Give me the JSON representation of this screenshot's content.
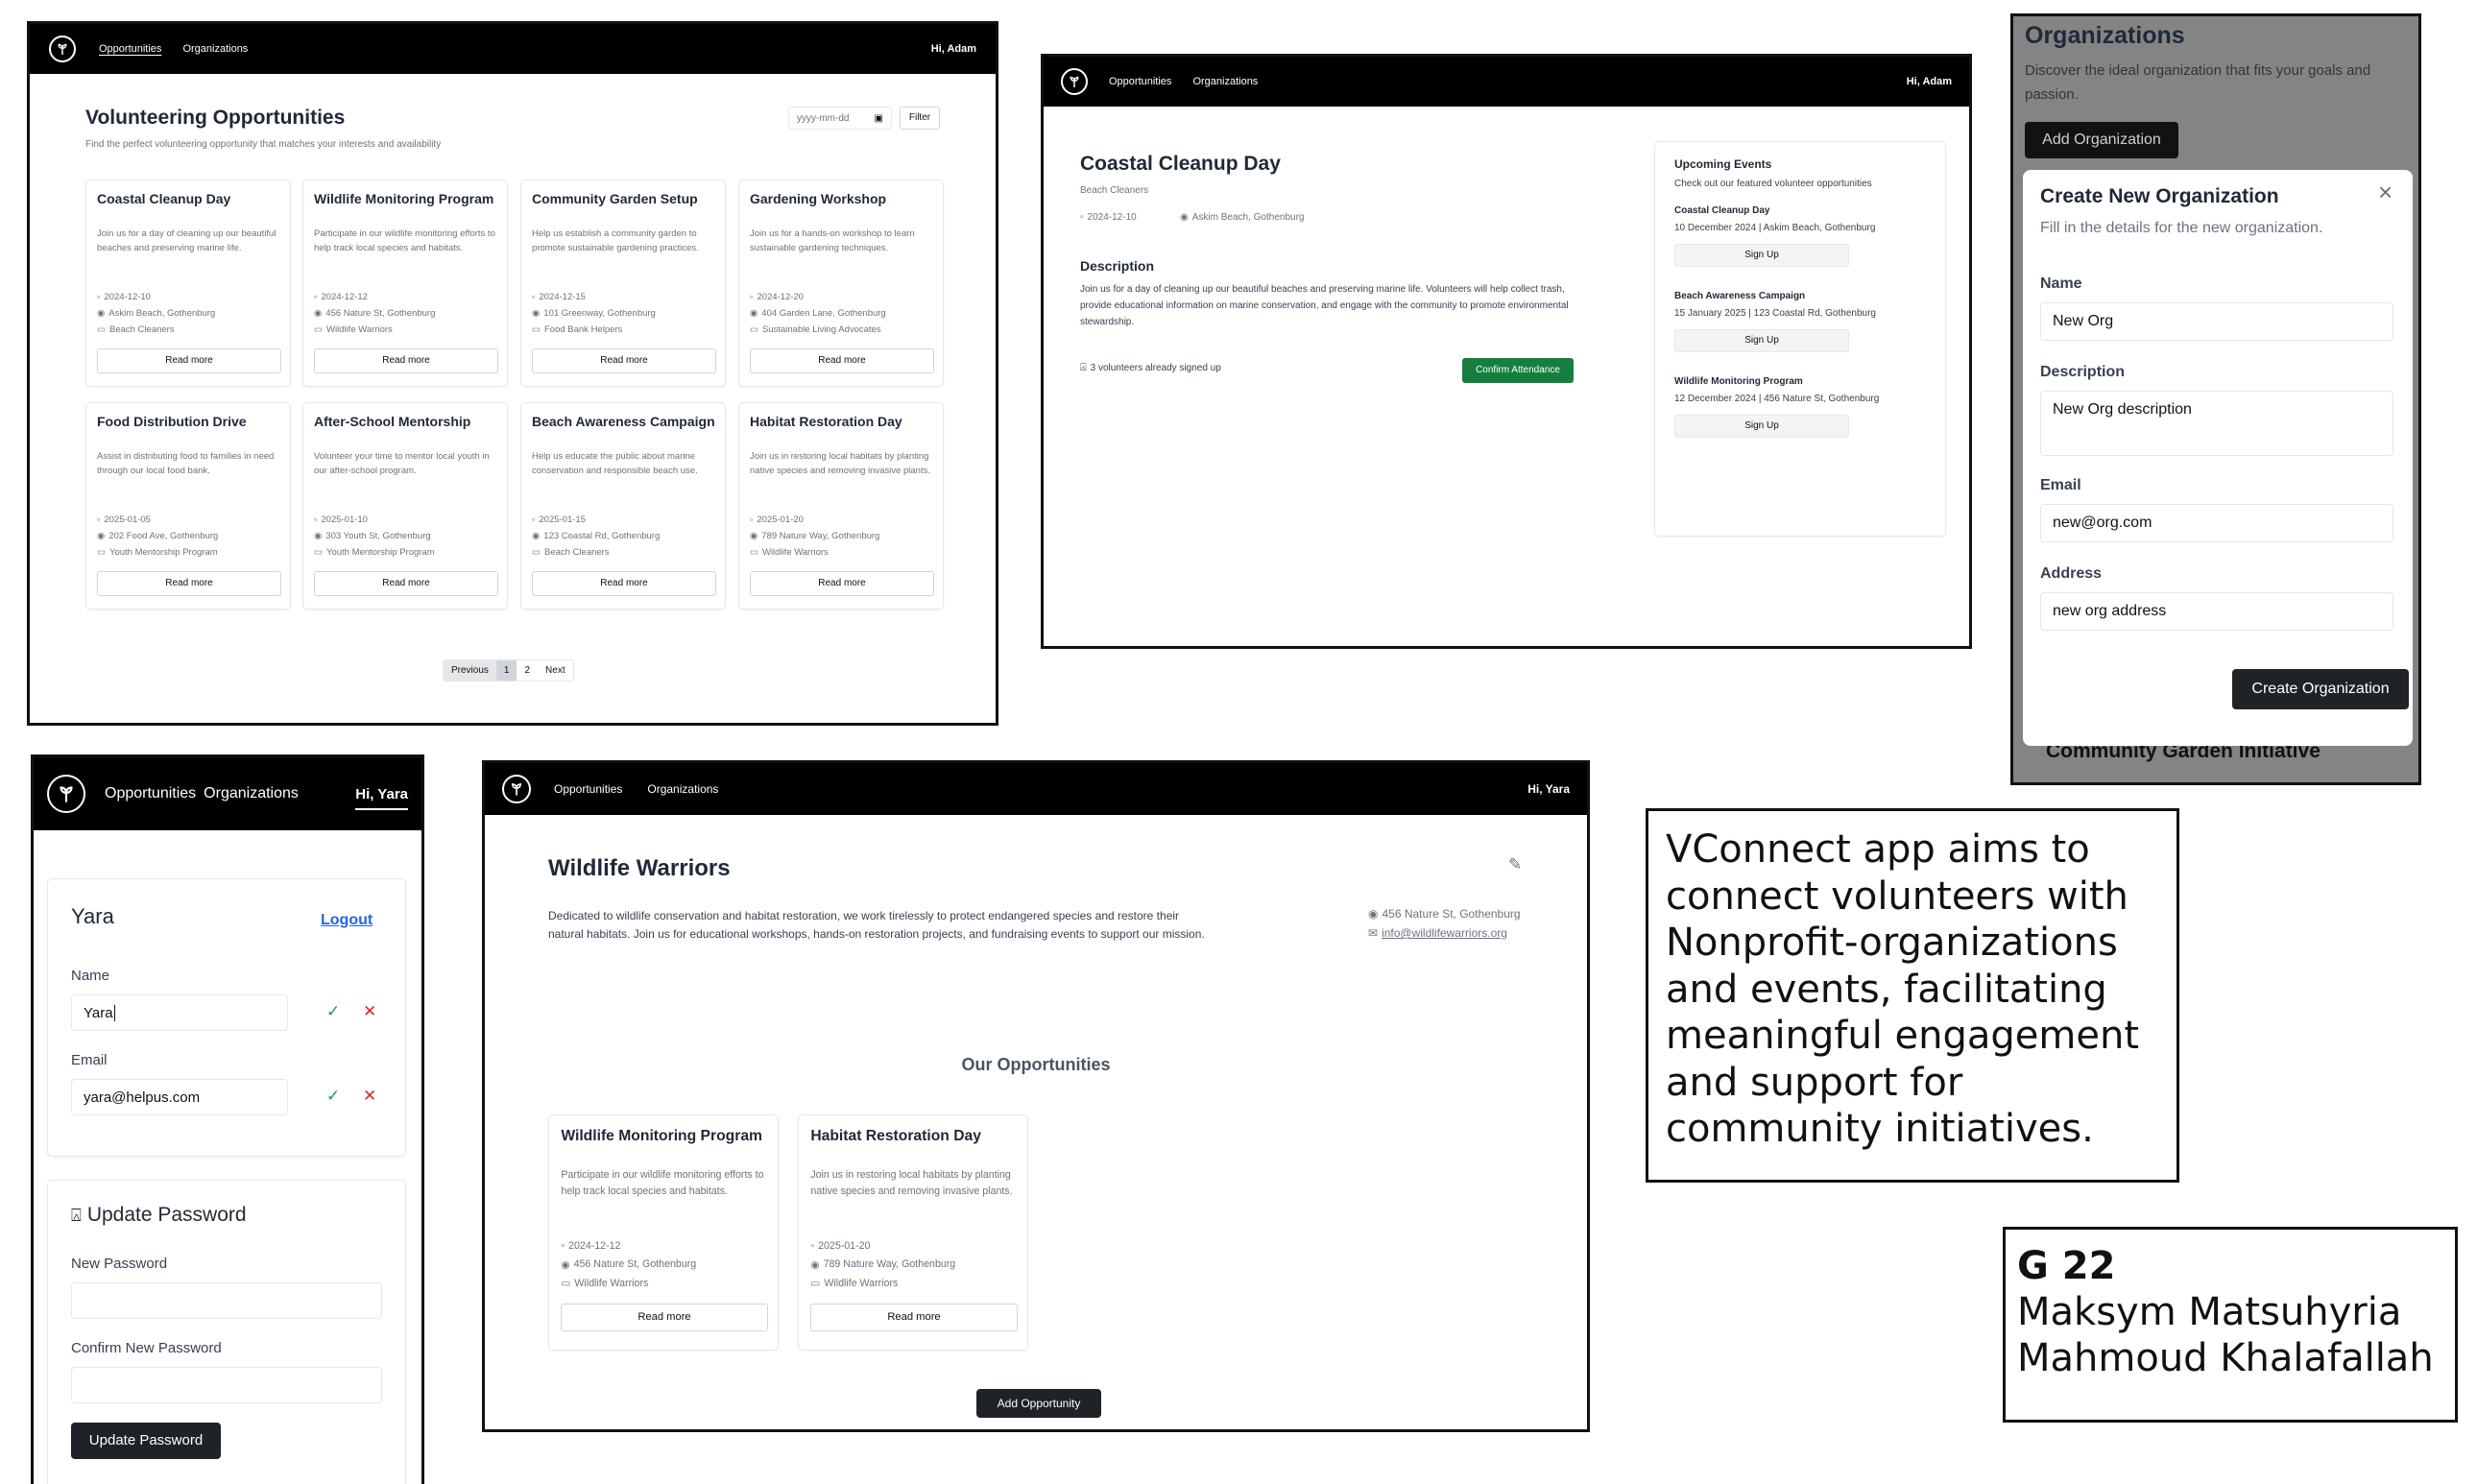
{
  "w1": {
    "nav": {
      "opportunities": "Opportunities",
      "organizations": "Organizations",
      "greeting": "Hi, Adam"
    },
    "title": "Volunteering Opportunities",
    "subtitle": "Find the perfect volunteering opportunity that matches your interests and availability",
    "date_placeholder": "yyyy-mm-dd",
    "filter": "Filter",
    "read_more": "Read more",
    "cards": [
      {
        "title": "Coastal Cleanup Day",
        "desc": "Join us for a day of cleaning up our beautiful beaches and preserving marine life.",
        "date": "2024-12-10",
        "loc": "Askim Beach, Gothenburg",
        "org": "Beach Cleaners"
      },
      {
        "title": "Wildlife Monitoring Program",
        "desc": "Participate in our wildlife monitoring efforts to help track local species and habitats.",
        "date": "2024-12-12",
        "loc": "456 Nature St, Gothenburg",
        "org": "Wildlife Warriors"
      },
      {
        "title": "Community Garden Setup",
        "desc": "Help us establish a community garden to promote sustainable gardening practices.",
        "date": "2024-12-15",
        "loc": "101 Greenway, Gothenburg",
        "org": "Food Bank Helpers"
      },
      {
        "title": "Gardening Workshop",
        "desc": "Join us for a hands-on workshop to learn sustainable gardening techniques.",
        "date": "2024-12-20",
        "loc": "404 Garden Lane, Gothenburg",
        "org": "Sustainable Living Advocates"
      },
      {
        "title": "Food Distribution Drive",
        "desc": "Assist in distributing food to families in need through our local food bank.",
        "date": "2025-01-05",
        "loc": "202 Food Ave, Gothenburg",
        "org": "Youth Mentorship Program"
      },
      {
        "title": "After-School Mentorship",
        "desc": "Volunteer your time to mentor local youth in our after-school program.",
        "date": "2025-01-10",
        "loc": "303 Youth St, Gothenburg",
        "org": "Youth Mentorship Program"
      },
      {
        "title": "Beach Awareness Campaign",
        "desc": "Help us educate the public about marine conservation and responsible beach use.",
        "date": "2025-01-15",
        "loc": "123 Coastal Rd, Gothenburg",
        "org": "Beach Cleaners"
      },
      {
        "title": "Habitat Restoration Day",
        "desc": "Join us in restoring local habitats by planting native species and removing invasive plants.",
        "date": "2025-01-20",
        "loc": "789 Nature Way, Gothenburg",
        "org": "Wildlife Warriors"
      }
    ],
    "pagination": {
      "prev": "Previous",
      "p1": "1",
      "p2": "2",
      "next": "Next"
    }
  },
  "w2": {
    "nav": {
      "opportunities": "Opportunities",
      "organizations": "Organizations",
      "greeting": "Hi, Adam"
    },
    "title": "Coastal Cleanup Day",
    "org": "Beach Cleaners",
    "date": "2024-12-10",
    "loc": "Askim Beach, Gothenburg",
    "desc_label": "Description",
    "desc": "Join us for a day of cleaning up our beautiful beaches and preserving marine life. Volunteers will help collect trash, provide educational information on marine conservation, and engage with the community to promote environmental stewardship.",
    "volunteers": "3 volunteers already signed up",
    "confirm": "Confirm Attendance",
    "upcoming": {
      "title": "Upcoming Events",
      "subtitle": "Check out our featured volunteer opportunities",
      "signup": "Sign Up",
      "events": [
        {
          "name": "Coastal Cleanup Day",
          "info": "10 December 2024 | Askim Beach, Gothenburg"
        },
        {
          "name": "Beach Awareness Campaign",
          "info": "15 January 2025 | 123 Coastal Rd, Gothenburg"
        },
        {
          "name": "Wildlife Monitoring Program",
          "info": "12 December 2024 | 456 Nature St, Gothenburg"
        }
      ]
    }
  },
  "w3": {
    "title": "Organizations",
    "subtitle": "Discover the ideal organization that fits your goals and passion.",
    "add": "Add Organization",
    "modal": {
      "title": "Create New Organization",
      "subtitle": "Fill in the details for the new organization.",
      "name_label": "Name",
      "name_value": "New Org",
      "desc_label": "Description",
      "desc_value": "New Org description",
      "email_label": "Email",
      "email_value": "new@org.com",
      "address_label": "Address",
      "address_value": "new org address",
      "submit": "Create Organization"
    },
    "behind": "Community Garden Initiative"
  },
  "w4": {
    "nav": {
      "opportunities": "Opportunities",
      "organizations": "Organizations",
      "greeting": "Hi, Yara"
    },
    "username": "Yara",
    "logout": "Logout",
    "name_label": "Name",
    "name_value": "Yara",
    "email_label": "Email",
    "email_value": "yara@helpus.com",
    "pw_title": "Update Password",
    "new_pw": "New Password",
    "confirm_pw": "Confirm New Password",
    "update": "Update Password"
  },
  "w5": {
    "nav": {
      "opportunities": "Opportunities",
      "organizations": "Organizations",
      "greeting": "Hi, Yara"
    },
    "title": "Wildlife Warriors",
    "desc": "Dedicated to wildlife conservation and habitat restoration, we work tirelessly to protect endangered species and restore their natural habitats. Join us for educational workshops, hands-on restoration projects, and fundraising events to support our mission.",
    "address": "456 Nature St, Gothenburg",
    "email": "info@wildlifewarriors.org",
    "section": "Our Opportunities",
    "read_more": "Read more",
    "add": "Add Opportunity",
    "cards": [
      {
        "title": "Wildlife Monitoring Program",
        "desc": "Participate in our wildlife monitoring efforts to help track local species and habitats.",
        "date": "2024-12-12",
        "loc": "456 Nature St, Gothenburg",
        "org": "Wildlife Warriors"
      },
      {
        "title": "Habitat Restoration Day",
        "desc": "Join us in restoring local habitats by planting native species and removing invasive plants.",
        "date": "2025-01-20",
        "loc": "789 Nature Way, Gothenburg",
        "org": "Wildlife Warriors"
      }
    ]
  },
  "description": "VConnect app aims to connect volunteers with Nonprofit-organizations and events, facilitating meaningful engagement and support for community initiatives.",
  "group": {
    "id": "G 22",
    "member1": "Maksym Matsuhyria",
    "member2": "Mahmoud Khalafallah"
  }
}
